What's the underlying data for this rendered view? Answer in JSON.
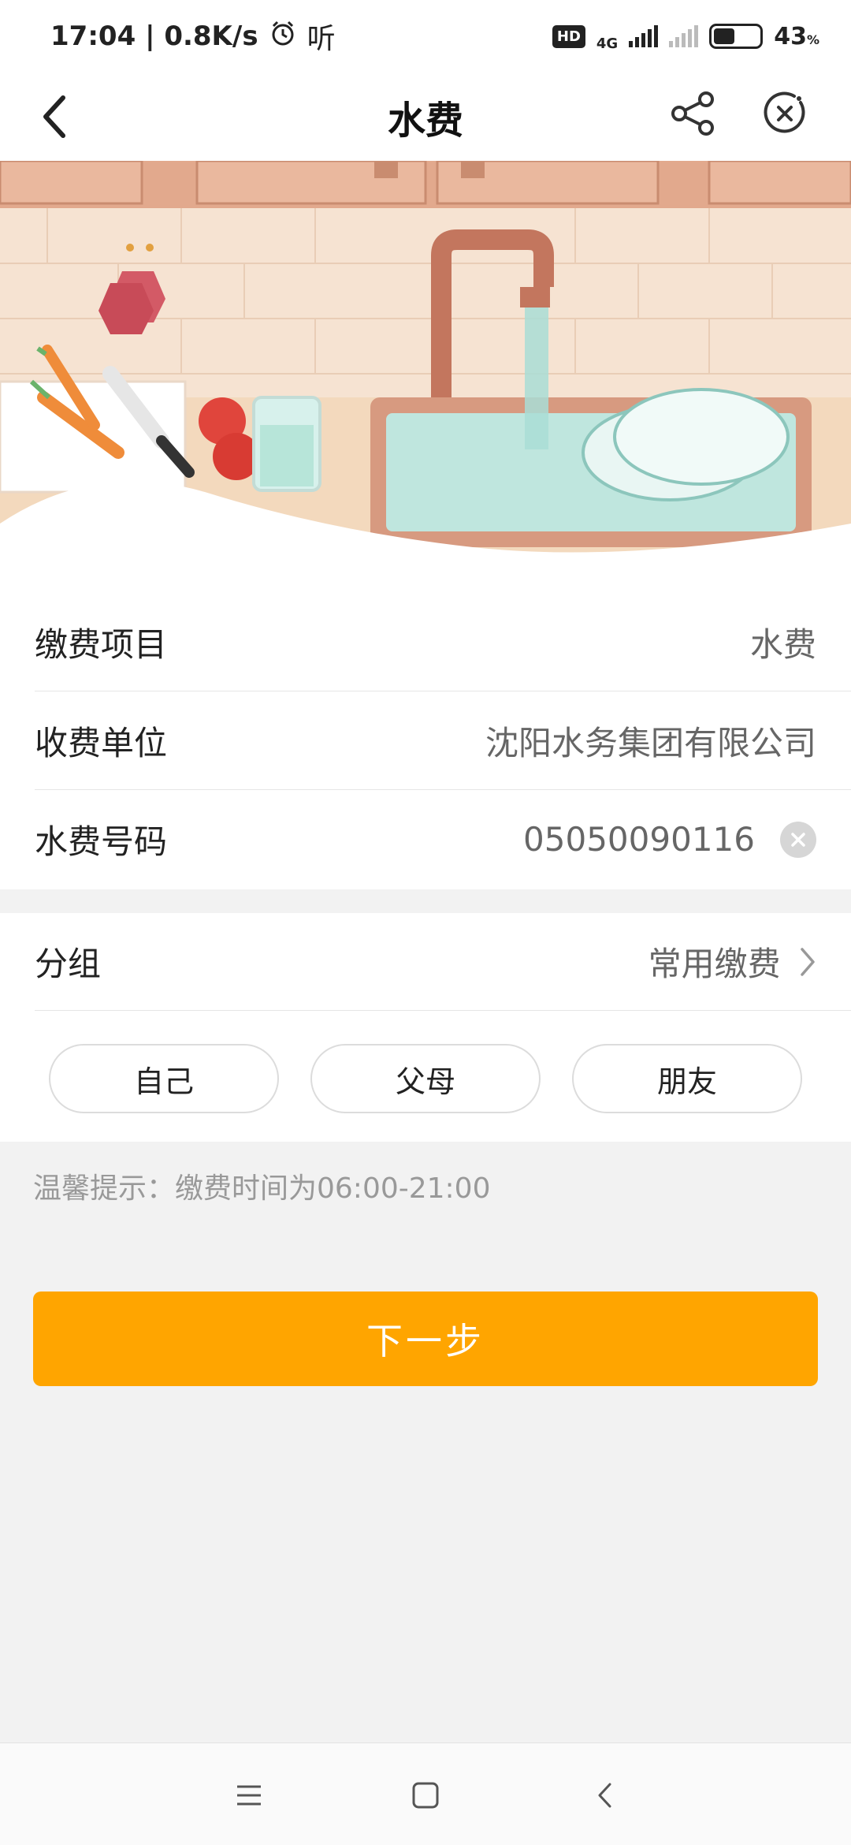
{
  "status_bar": {
    "time_speed": "17:04 | 0.8K/s",
    "listen_label": "听",
    "hd_badge": "HD",
    "network": "4G",
    "battery": "43",
    "battery_unit": "%"
  },
  "nav": {
    "title": "水费"
  },
  "form": {
    "item_label": "缴费项目",
    "item_value": "水费",
    "unit_label": "收费单位",
    "unit_value": "沈阳水务集团有限公司",
    "number_label": "水费号码",
    "number_value": "05050090116"
  },
  "group": {
    "label": "分组",
    "value": "常用缴费",
    "options": [
      "自己",
      "父母",
      "朋友"
    ]
  },
  "tip": "温馨提示：缴费时间为06:00-21:00",
  "next_button": "下一步",
  "icons": {
    "back": "back-arrow-icon",
    "share": "share-icon",
    "close": "close-circle-icon",
    "clear": "clear-icon",
    "chevron": "chevron-right-icon",
    "alarm": "alarm-icon",
    "menu": "menu-icon",
    "home": "home-icon",
    "sys_back": "back-icon"
  },
  "colors": {
    "accent": "#ffa500",
    "banner_wall": "#f6e3d2",
    "banner_cabinet": "#e8b79c"
  }
}
